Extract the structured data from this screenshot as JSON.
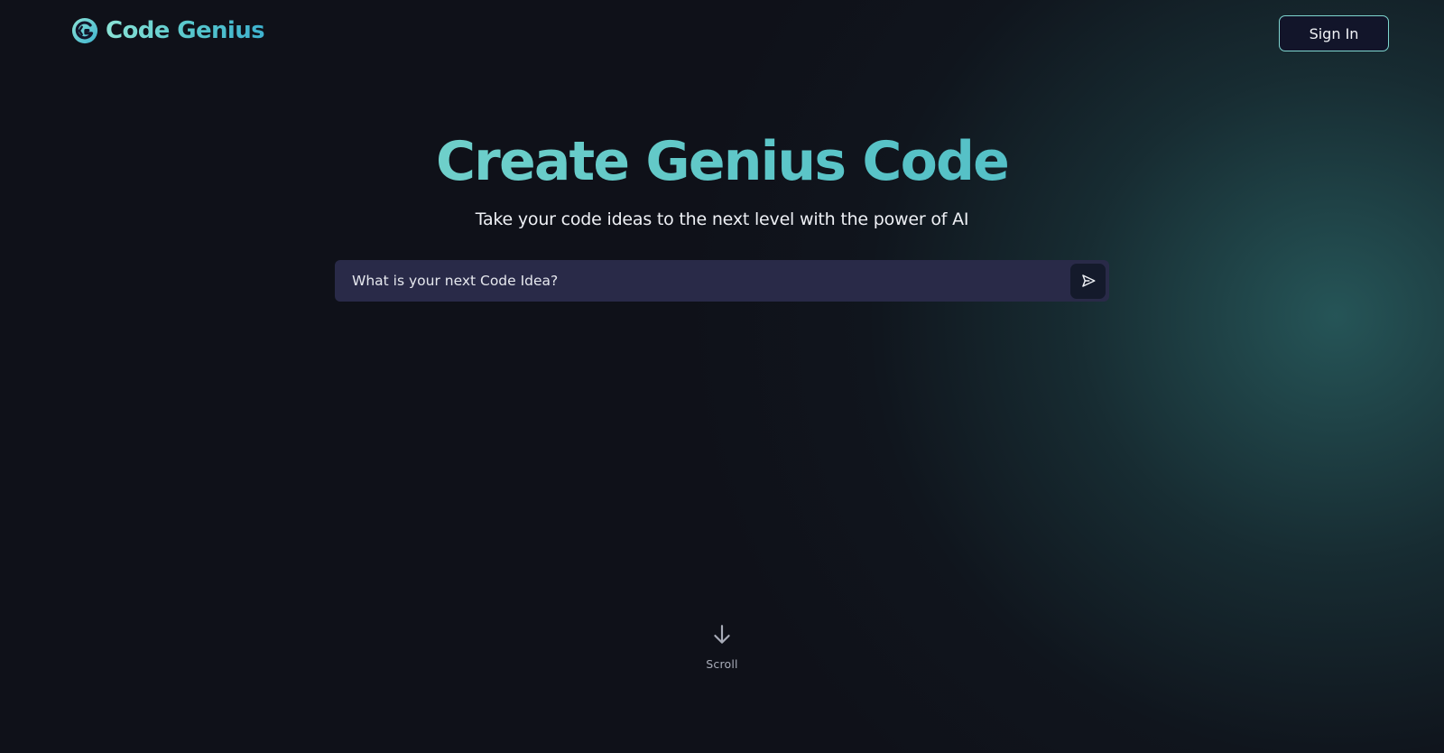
{
  "header": {
    "brand": "Code Genius",
    "sign_in_label": "Sign In"
  },
  "hero": {
    "title": "Create Genius Code",
    "subtitle": "Take your code ideas to the next level with the power of AI"
  },
  "prompt": {
    "placeholder": "What is your next Code Idea?",
    "value": "",
    "send_icon": "send-icon"
  },
  "scroll": {
    "label": "Scroll",
    "icon": "arrow-down-icon"
  },
  "colors": {
    "background": "#0f1119",
    "accent": "#5cc8c8",
    "input_background": "#292a48",
    "sign_in_border": "#7fd6d0"
  }
}
